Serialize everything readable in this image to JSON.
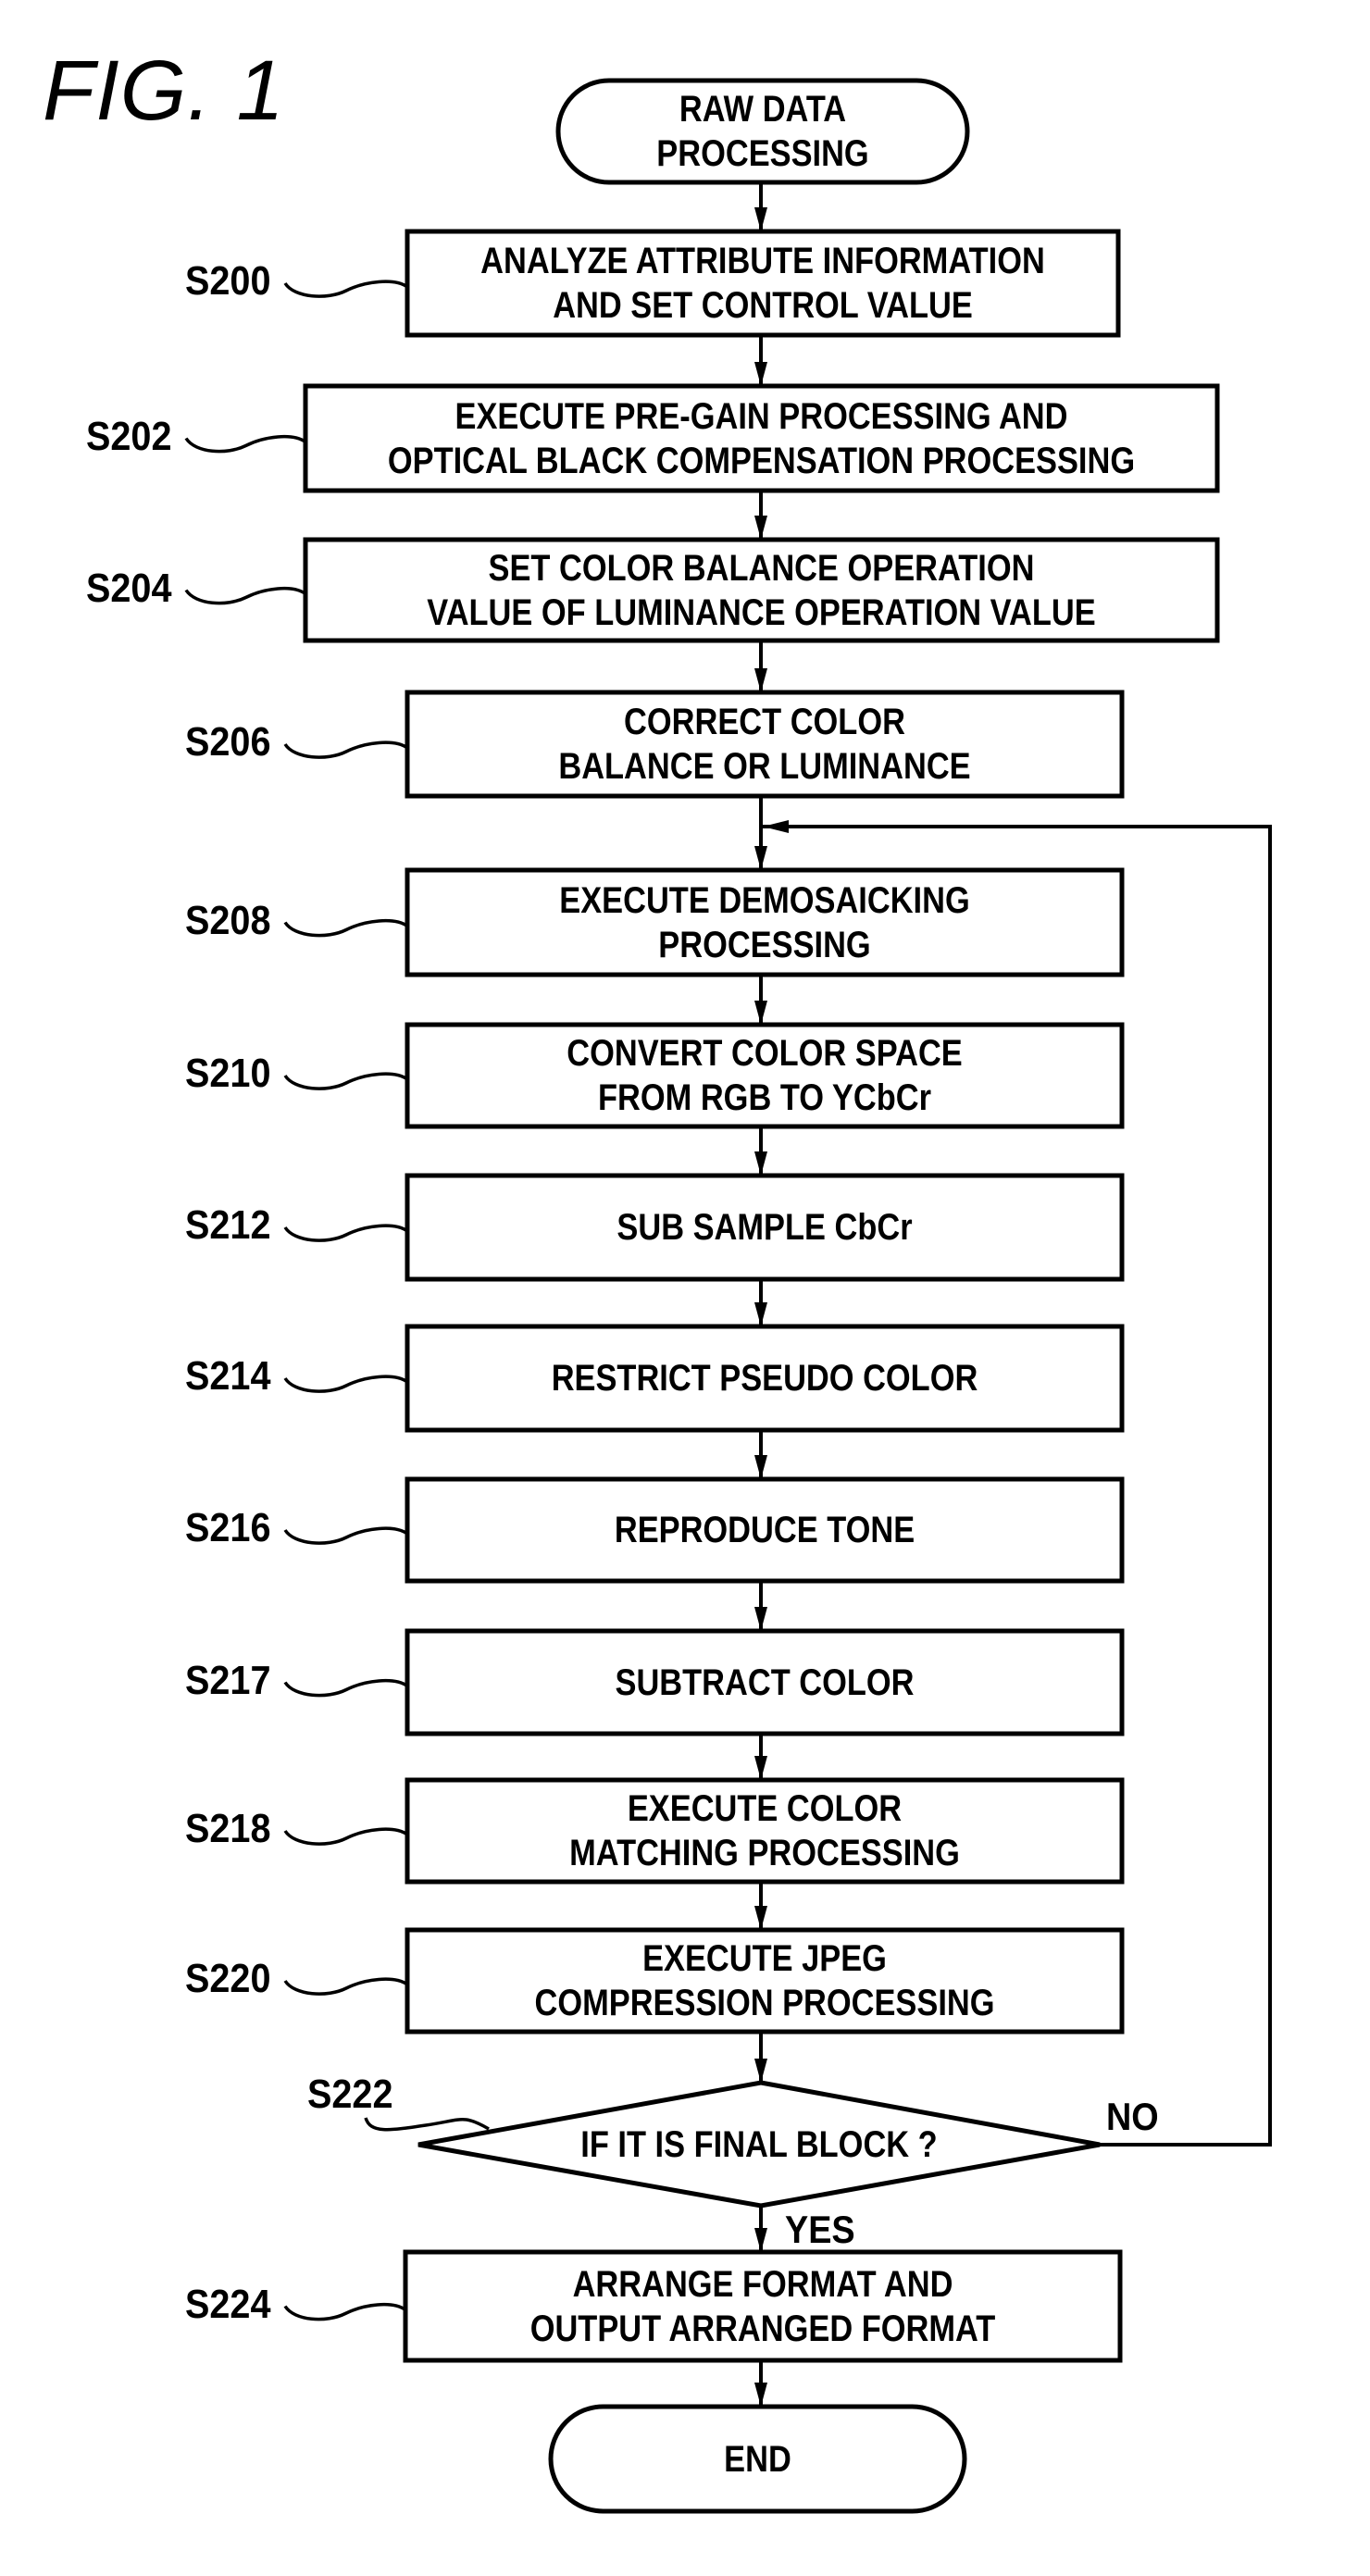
{
  "figure": {
    "title": "FIG. 1"
  },
  "start": {
    "text": "RAW DATA\nPROCESSING"
  },
  "steps": [
    {
      "id": "S200",
      "text": "ANALYZE ATTRIBUTE INFORMATION\nAND SET CONTROL VALUE"
    },
    {
      "id": "S202",
      "text": "EXECUTE PRE-GAIN PROCESSING AND\nOPTICAL BLACK COMPENSATION PROCESSING"
    },
    {
      "id": "S204",
      "text": "SET COLOR BALANCE OPERATION\nVALUE OF LUMINANCE OPERATION VALUE"
    },
    {
      "id": "S206",
      "text": "CORRECT COLOR\nBALANCE OR LUMINANCE"
    },
    {
      "id": "S208",
      "text": "EXECUTE DEMOSAICKING\nPROCESSING"
    },
    {
      "id": "S210",
      "text": "CONVERT COLOR SPACE\nFROM RGB TO YCbCr"
    },
    {
      "id": "S212",
      "text": "SUB SAMPLE CbCr"
    },
    {
      "id": "S214",
      "text": "RESTRICT PSEUDO COLOR"
    },
    {
      "id": "S216",
      "text": "REPRODUCE TONE"
    },
    {
      "id": "S217",
      "text": "SUBTRACT COLOR"
    },
    {
      "id": "S218",
      "text": "EXECUTE COLOR\nMATCHING PROCESSING"
    },
    {
      "id": "S220",
      "text": "EXECUTE JPEG\nCOMPRESSION PROCESSING"
    }
  ],
  "decision": {
    "id": "S222",
    "text": "IF IT IS FINAL BLOCK ?",
    "yes_label": "YES",
    "no_label": "NO"
  },
  "final_step": {
    "id": "S224",
    "text": "ARRANGE FORMAT AND\nOUTPUT ARRANGED FORMAT"
  },
  "end": {
    "text": "END"
  }
}
